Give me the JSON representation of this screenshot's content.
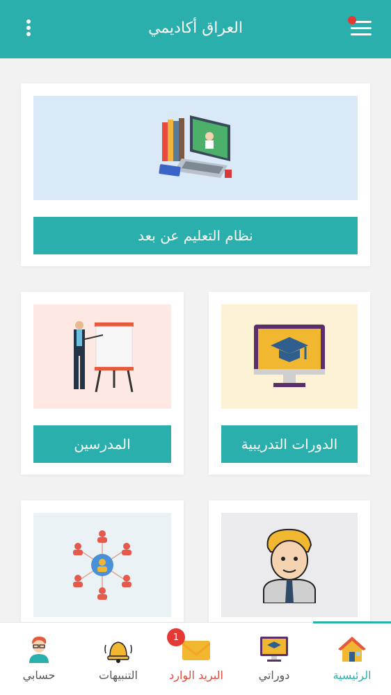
{
  "header": {
    "title": "العراق أكاديمي",
    "menu_icon": "hamburger-menu-icon",
    "more_icon": "vertical-dots-icon",
    "notification_dot_color": "#e53935",
    "accent": "#2aafac"
  },
  "cards": [
    {
      "label": "نظام التعليم عن بعد",
      "illustration": "laptop-online-learning-icon"
    },
    {
      "label": "الدورات التدريبية",
      "illustration": "monitor-graduation-cap-icon"
    },
    {
      "label": "المدرسين",
      "illustration": "teacher-whiteboard-icon"
    },
    {
      "label": "",
      "illustration": "student-avatar-icon"
    },
    {
      "label": "",
      "illustration": "network-people-icon"
    }
  ],
  "bottom_nav": {
    "items": [
      {
        "label": "الرئيسية",
        "icon": "home-icon",
        "active": true
      },
      {
        "label": "دوراتي",
        "icon": "courses-monitor-icon"
      },
      {
        "label": "البريد الوارد",
        "icon": "mail-envelope-icon",
        "badge": "1"
      },
      {
        "label": "التنبيهات",
        "icon": "bell-icon"
      },
      {
        "label": "حسابي",
        "icon": "profile-avatar-icon"
      }
    ]
  }
}
